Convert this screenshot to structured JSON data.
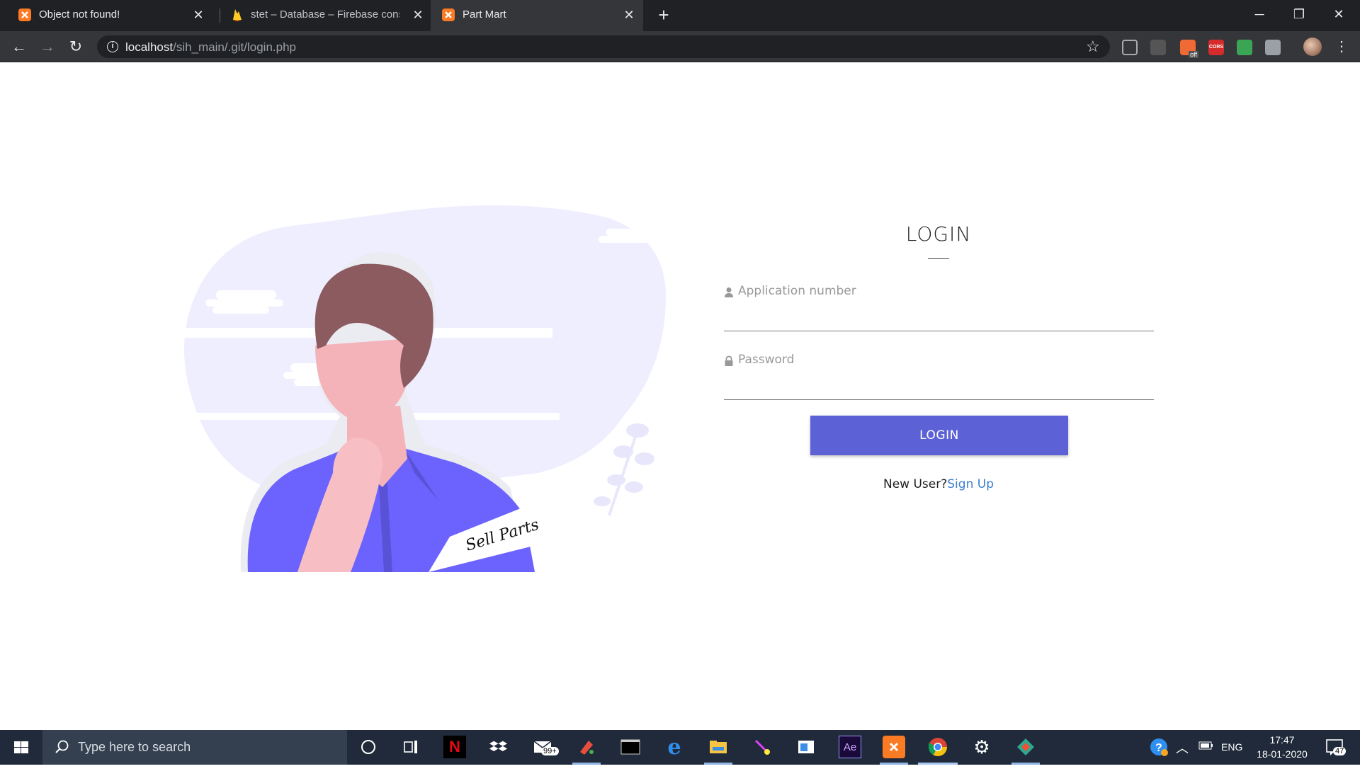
{
  "browser": {
    "tabs": [
      {
        "title": "Object not found!",
        "favicon": "xampp-icon",
        "active": false
      },
      {
        "title": "stet – Database – Firebase conso",
        "favicon": "firebase-icon",
        "active": false
      },
      {
        "title": "Part Mart",
        "favicon": "xampp-icon",
        "active": true
      }
    ],
    "new_tab_symbol": "+",
    "url_host": "localhost",
    "url_path": "/sih_main/.git/login.php",
    "extensions": [
      "c-extension-icon",
      "bug-extension-icon",
      "off-extension-icon",
      "cors-extension-icon",
      "check-extension-icon",
      "copy-extension-icon"
    ],
    "extension_badge": "off",
    "cors_badge": "CORS"
  },
  "illustration": {
    "banner_text": "Sell Parts",
    "accent": "#6c63ff"
  },
  "login": {
    "title": "LOGIN",
    "app_number_placeholder": "Application number",
    "password_placeholder": "Password",
    "button_label": "LOGIN",
    "new_user_text": "New User?",
    "signup_link": "Sign Up",
    "button_color": "#5c62d6",
    "link_color": "#3b7fd1"
  },
  "taskbar": {
    "search_placeholder": "Type here to search",
    "mail_badge": "99+",
    "language": "ENG",
    "time": "17:47",
    "date": "18-01-2020",
    "notification_count": "47"
  }
}
